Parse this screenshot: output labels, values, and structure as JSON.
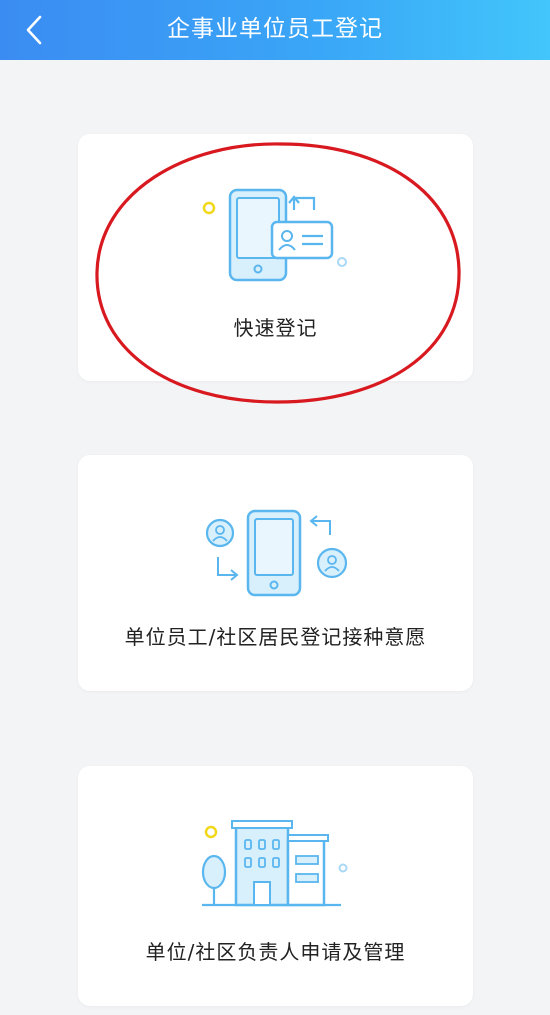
{
  "header": {
    "title": "企事业单位员工登记"
  },
  "cards": [
    {
      "label": "快速登记"
    },
    {
      "label": "单位员工/社区居民登记接种意愿"
    },
    {
      "label": "单位/社区负责人申请及管理"
    }
  ],
  "colors": {
    "header_start": "#3b8cf2",
    "header_end": "#42c6fb",
    "icon_blue": "#5ab6ee",
    "icon_fill": "#d8effc",
    "accent_yellow": "#f2d81a",
    "annotation_red": "#d8191f"
  }
}
